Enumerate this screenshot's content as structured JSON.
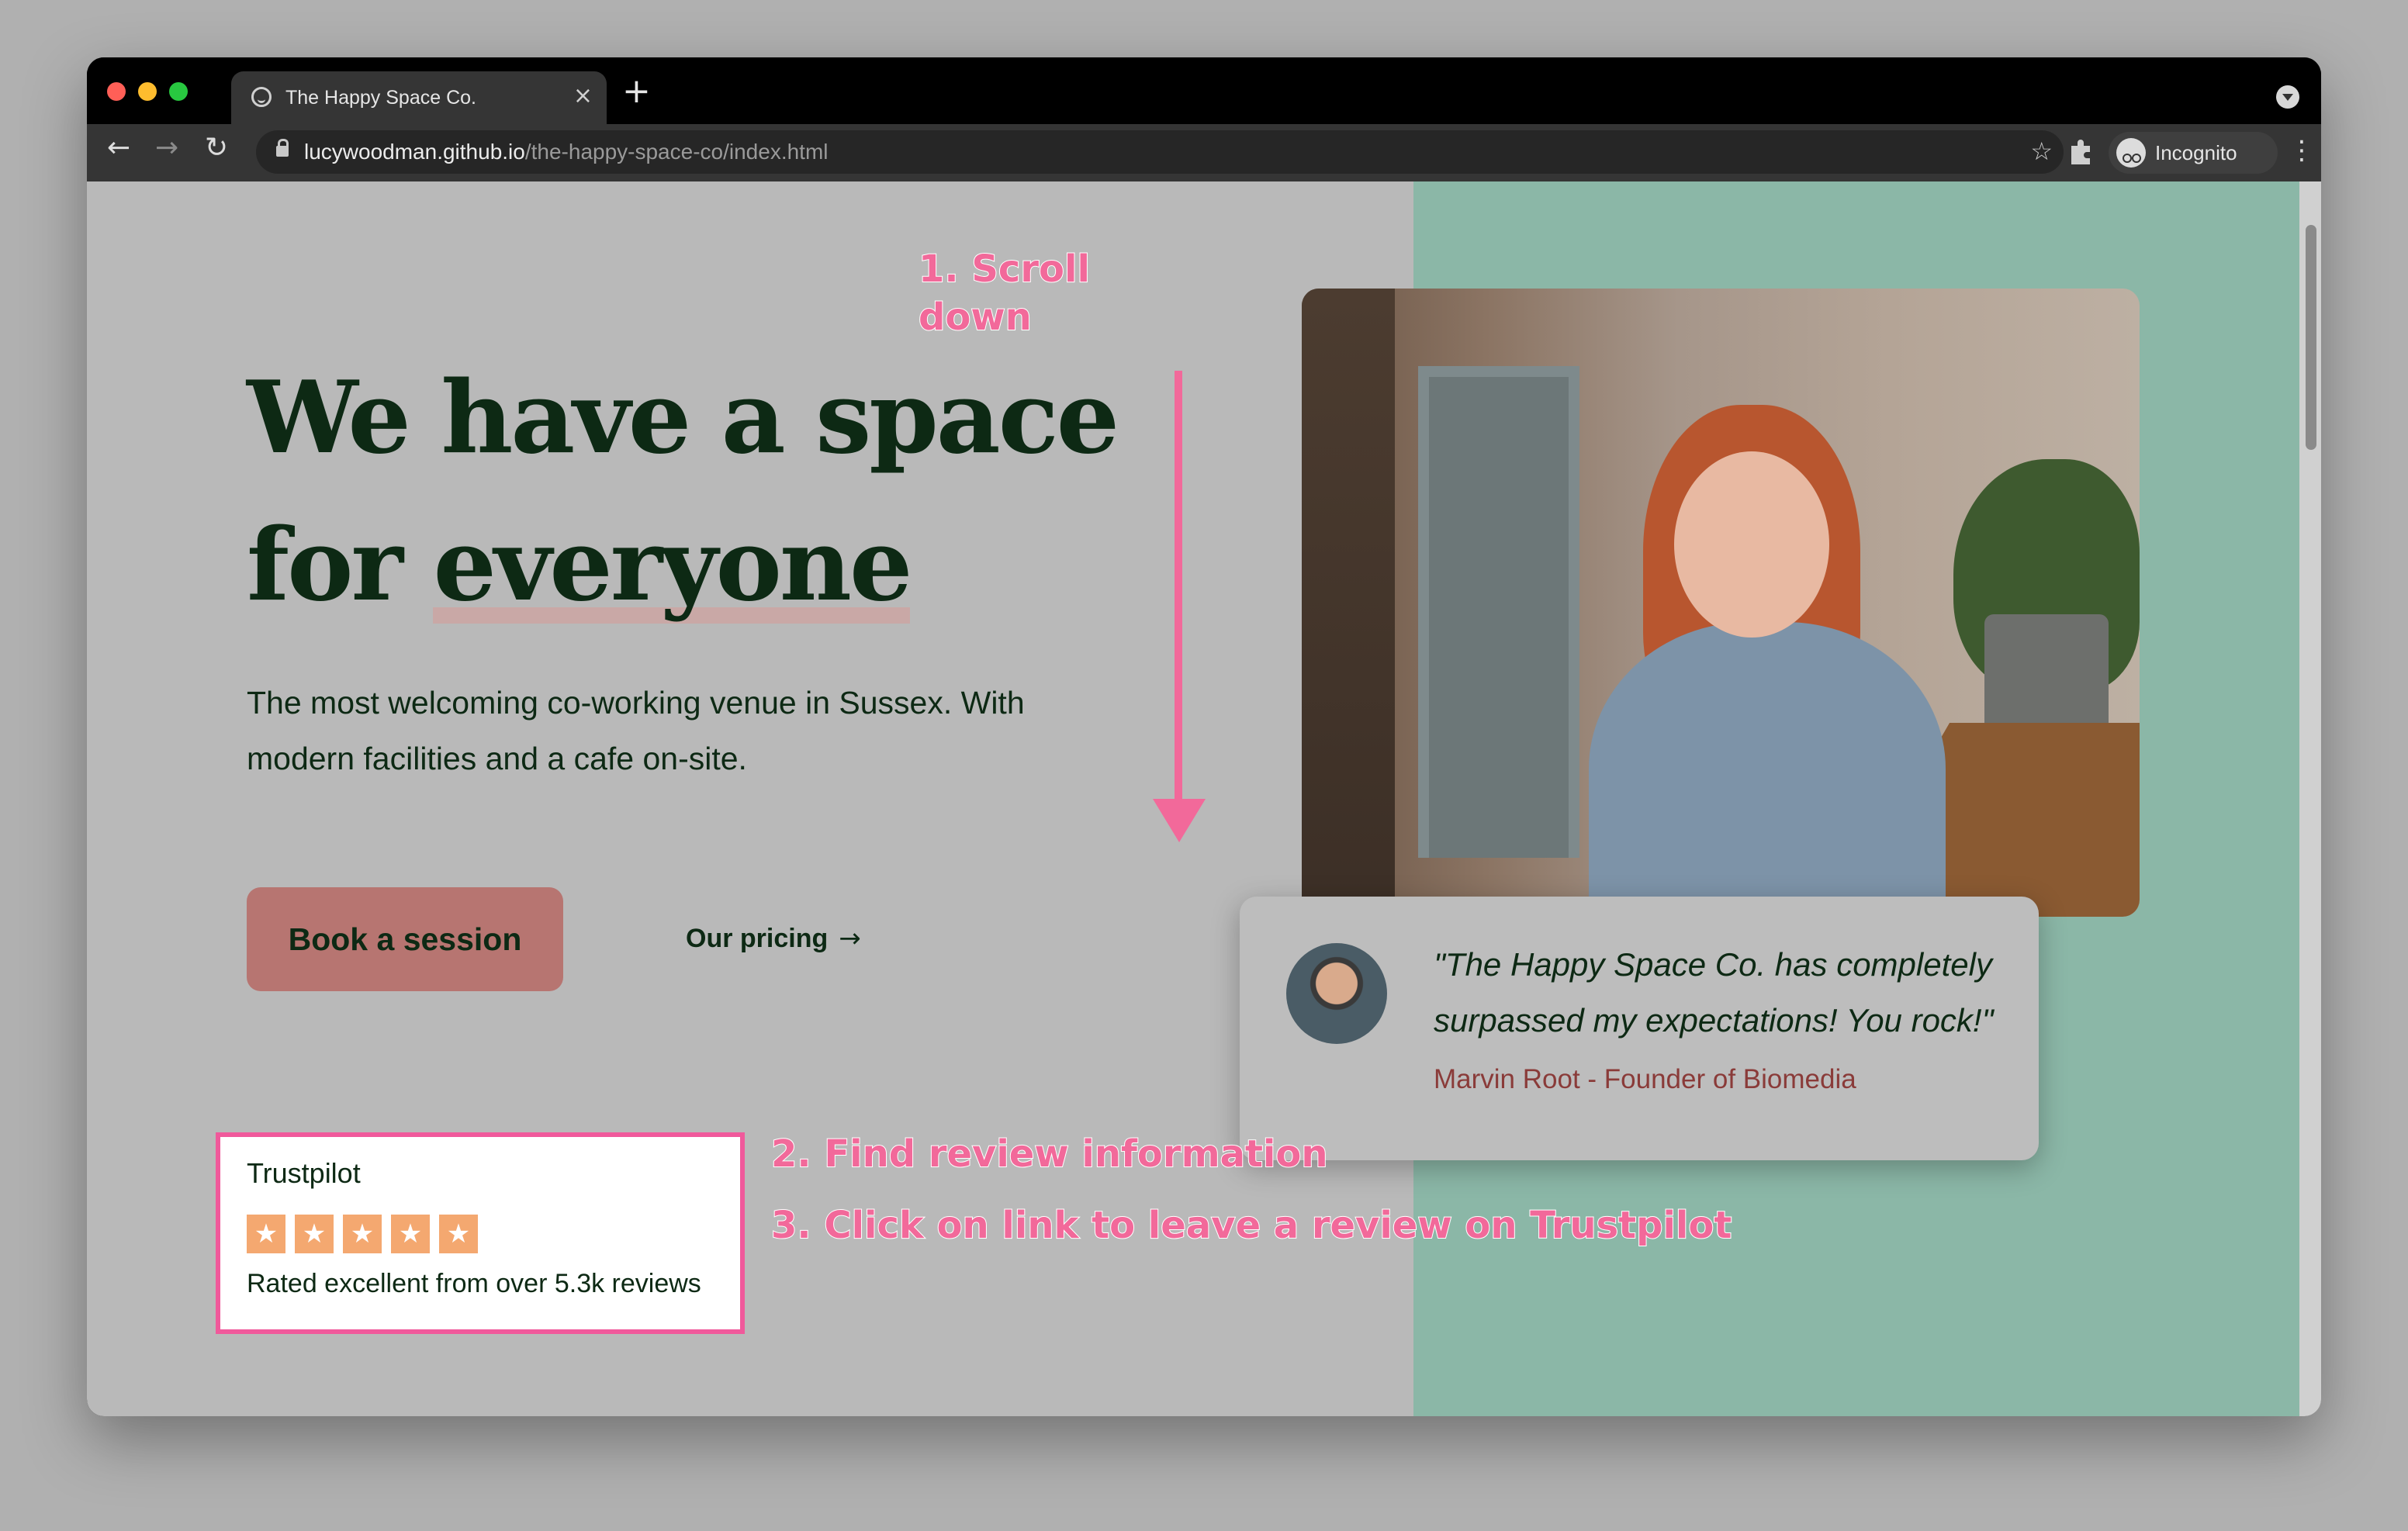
{
  "browser": {
    "tab_title": "The Happy Space Co.",
    "tab_close": "×",
    "new_tab": "+",
    "url_host": "lucywoodman.github.io",
    "url_path": "/the-happy-space-co/index.html",
    "profile_label": "Incognito",
    "icons": {
      "back": "←",
      "forward": "→",
      "reload": "↻",
      "bookmark": "☆",
      "extensions": "extensions-icon",
      "menu": "⋮"
    },
    "traffic_lights": {
      "close": "#ff5f57",
      "minimize": "#febc2e",
      "maximize": "#28c840"
    }
  },
  "hero": {
    "headline_line1": "We have a space",
    "headline_line2_a": "for ",
    "headline_line2_b": "everyone",
    "subtitle": "The most welcoming co-working venue in Sussex. With modern facilities and a cafe on-site.",
    "book_button": "Book a session",
    "pricing_link": "Our pricing",
    "pricing_arrow": "→"
  },
  "trustpilot": {
    "title": "Trustpilot",
    "stars": [
      "★",
      "★",
      "★",
      "★",
      "★"
    ],
    "rating": 5,
    "text": "Rated excellent from over 5.3k reviews"
  },
  "testimonial": {
    "quote": "\"The Happy Space Co. has completely surpassed my expectations! You rock!\"",
    "author": "Marvin Root - Founder of Biomedia"
  },
  "annotations": {
    "step1_line1": "1. Scroll",
    "step1_line2": "down",
    "step2": "2. Find review information",
    "step3": "3. Click on link to leave a review on Trustpilot"
  },
  "colors": {
    "brand_dark": "#0d2914",
    "button": "#b77571",
    "accent_teal": "#8bb7a7",
    "annotation_pink": "#f2699a",
    "star_orange": "#f4a870",
    "author_red": "#8a3b39"
  }
}
